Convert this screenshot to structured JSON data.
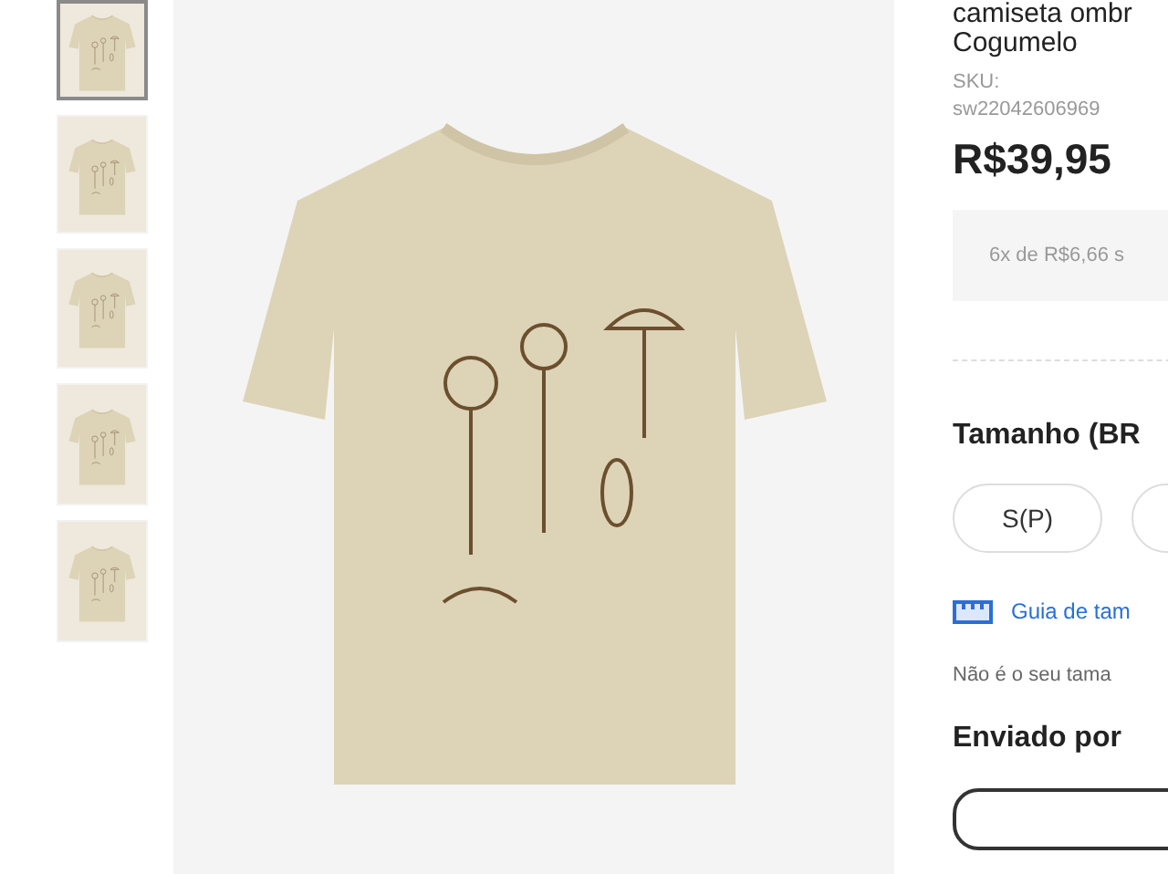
{
  "thumbnails": [
    {
      "selected": true
    },
    {
      "selected": false
    },
    {
      "selected": false
    },
    {
      "selected": false
    },
    {
      "selected": false
    }
  ],
  "product": {
    "title_lines": [
      "camiseta ombr",
      "Cogumelo"
    ],
    "sku_label": "SKU:",
    "sku": "sw22042606969",
    "price": "R$39,95",
    "installments": "6x de R$6,66 s"
  },
  "size": {
    "heading": "Tamanho (BR",
    "options": [
      {
        "label": "S(P)",
        "selected": false
      }
    ],
    "guide_link": "Guia de tam",
    "fit_note": "Não é o seu tama"
  },
  "shipping": {
    "heading": "Enviado por"
  }
}
